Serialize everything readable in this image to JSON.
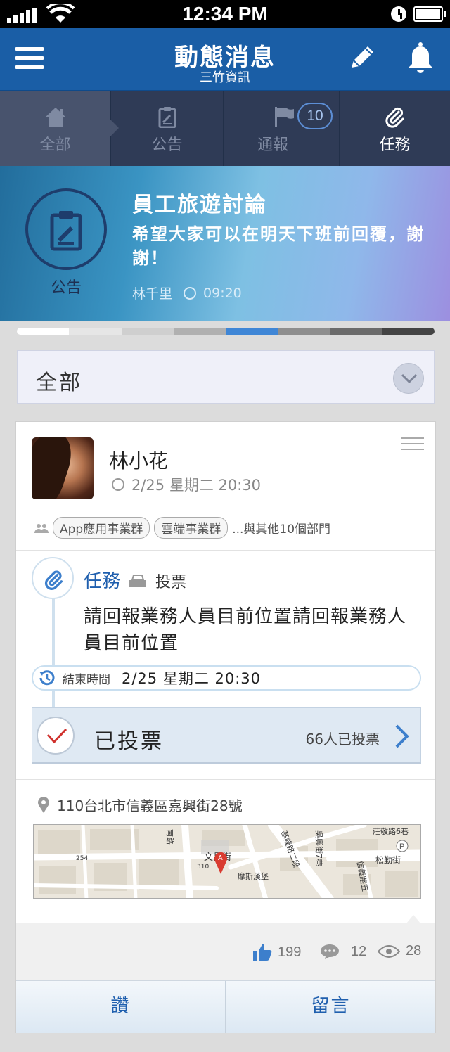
{
  "status_bar": {
    "time": "12:34 PM"
  },
  "header": {
    "title": "動態消息",
    "subtitle": "三竹資訊"
  },
  "tabs": [
    {
      "label": "全部",
      "icon": "home-icon"
    },
    {
      "label": "公告",
      "icon": "clipboard-icon"
    },
    {
      "label": "通報",
      "icon": "flag-icon",
      "badge": "10"
    },
    {
      "label": "任務",
      "icon": "paperclip-icon"
    }
  ],
  "banner": {
    "category": "公告",
    "title": "員工旅遊討論",
    "message": "希望大家可以在明天下班前回覆，謝謝！",
    "author": "林千里",
    "time": "09:20"
  },
  "filter": {
    "selected": "全部"
  },
  "post": {
    "author": "林小花",
    "datetime": "2/25 星期二 20:30",
    "departments": [
      "App應用事業群",
      "雲端事業群"
    ],
    "departments_more": "...與其他10個部門",
    "task_type": "任務",
    "task_subtype": "投票",
    "content": "請回報業務人員目前位置請回報業務人員目前位置",
    "deadline_label": "結束時間",
    "deadline_value": "2/25 星期二 20:30",
    "vote_status": "已投票",
    "vote_count": "66人已投票",
    "address": "110台北市信義區嘉興街28號",
    "map_labels": [
      "文昌街",
      "摩斯漢堡",
      "松勤街",
      "莊敬路6巷",
      "基隆路二段",
      "吳興街7巷",
      "信義路五",
      "南路",
      "254",
      "310"
    ],
    "likes": "199",
    "comments": "12",
    "views": "28",
    "like_action": "讚",
    "comment_action": "留言"
  },
  "colors": {
    "brand": "#1a5ea6",
    "tab_bg": "#2f3b56",
    "accent_blue": "#1f5fae",
    "check_red": "#d0312d"
  }
}
